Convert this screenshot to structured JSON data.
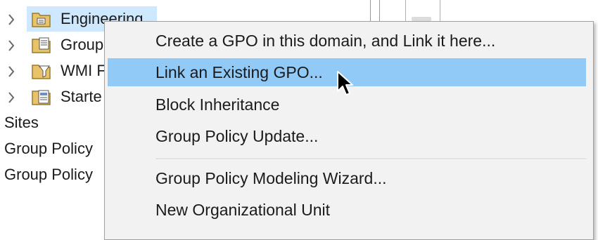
{
  "tree": {
    "items": [
      {
        "label": "Engineering",
        "icon": "ou-folder-icon",
        "selected": true
      },
      {
        "label": "Group",
        "icon": "gpo-folder-icon",
        "selected": false
      },
      {
        "label": "WMI F",
        "icon": "wmi-filter-folder-icon",
        "selected": false
      },
      {
        "label": "Starte",
        "icon": "starter-gpo-folder-icon",
        "selected": false
      }
    ],
    "plain_items": [
      "Sites",
      "Group Policy",
      "Group Policy"
    ]
  },
  "context_menu": {
    "items": [
      "Create a GPO in this domain, and Link it here...",
      "Link an Existing GPO...",
      "Block Inheritance",
      "Group Policy Update...",
      "Group Policy Modeling Wizard...",
      "New Organizational Unit"
    ],
    "highlighted_index": 1
  },
  "colors": {
    "menu_background": "#f2f2f2",
    "menu_highlight": "#91c9f7",
    "tree_selection": "#cde8ff",
    "folder": "#e8c36a"
  }
}
